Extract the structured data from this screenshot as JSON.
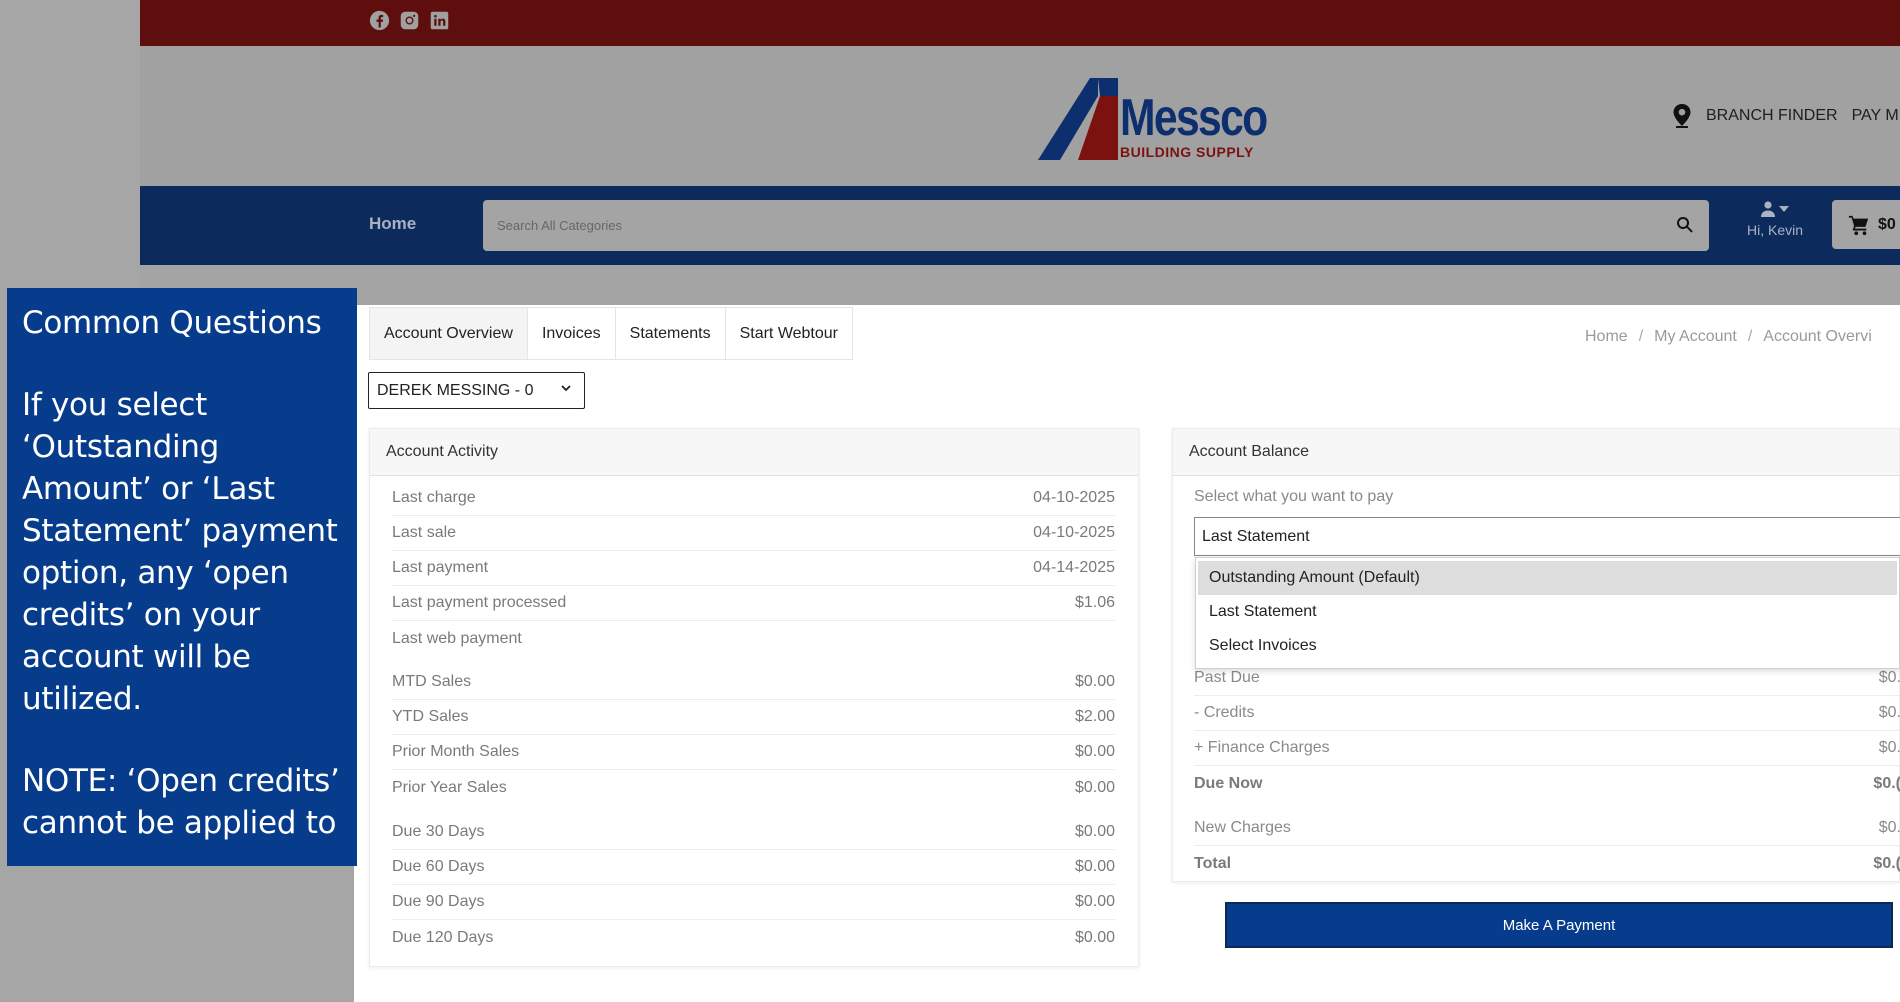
{
  "callout": {
    "title": "Common Questions",
    "body": "If you select ‘Outstanding Amount’ or ‘Last Statement’ payment option, any ‘open credits’ on your account will be utilized.",
    "note": "NOTE: ‘Open credits’ cannot be applied to"
  },
  "social_icons": [
    "facebook-icon",
    "instagram-icon",
    "linkedin-icon"
  ],
  "logo": {
    "word": "Messco",
    "tagline": "BUILDING SUPPLY"
  },
  "header_links": {
    "branch_finder": "BRANCH FINDER",
    "pay": "PAY M"
  },
  "nav": {
    "home": "Home",
    "search_placeholder": "Search All Categories",
    "greeting": "Hi, Kevin",
    "cart_amount": "$0"
  },
  "tabs": [
    "Account Overview",
    "Invoices",
    "Statements",
    "Start Webtour"
  ],
  "breadcrumb": [
    "Home",
    "My Account",
    "Account Overvi"
  ],
  "account_selector": "DEREK MESSING - 0",
  "activity": {
    "title": "Account Activity",
    "rows": [
      {
        "label": "Last charge",
        "value": "04-10-2025"
      },
      {
        "label": "Last sale",
        "value": "04-10-2025"
      },
      {
        "label": "Last payment",
        "value": "04-14-2025"
      },
      {
        "label": "Last payment processed",
        "value": "$1.06"
      },
      {
        "label": "Last web payment",
        "value": ""
      },
      {
        "label": "MTD Sales",
        "value": "$0.00"
      },
      {
        "label": "YTD Sales",
        "value": "$2.00"
      },
      {
        "label": "Prior Month Sales",
        "value": "$0.00"
      },
      {
        "label": "Prior Year Sales",
        "value": "$0.00"
      },
      {
        "label": "Due 30 Days",
        "value": "$0.00"
      },
      {
        "label": "Due 60 Days",
        "value": "$0.00"
      },
      {
        "label": "Due 90 Days",
        "value": "$0.00"
      },
      {
        "label": "Due 120 Days",
        "value": "$0.00"
      }
    ]
  },
  "balance": {
    "title": "Account Balance",
    "select_label": "Select what you want to pay",
    "selected": "Last Statement",
    "options": [
      "Outstanding Amount (Default)",
      "Last Statement",
      "Select Invoices"
    ],
    "rows": [
      {
        "label": "Past Due",
        "value": "$0."
      },
      {
        "label": "- Credits",
        "value": "$0."
      },
      {
        "label": "+ Finance Charges",
        "value": "$0."
      },
      {
        "label": "Due Now",
        "value": "$0.("
      },
      {
        "label": "New Charges",
        "value": "$0."
      },
      {
        "label": "Total",
        "value": "$0.("
      }
    ]
  },
  "pay_button": "Make A Payment",
  "colors": {
    "topbar": "#5e0f0d",
    "navbar": "#0c2b5c",
    "callout": "#073c8c",
    "button": "#073c8c"
  }
}
